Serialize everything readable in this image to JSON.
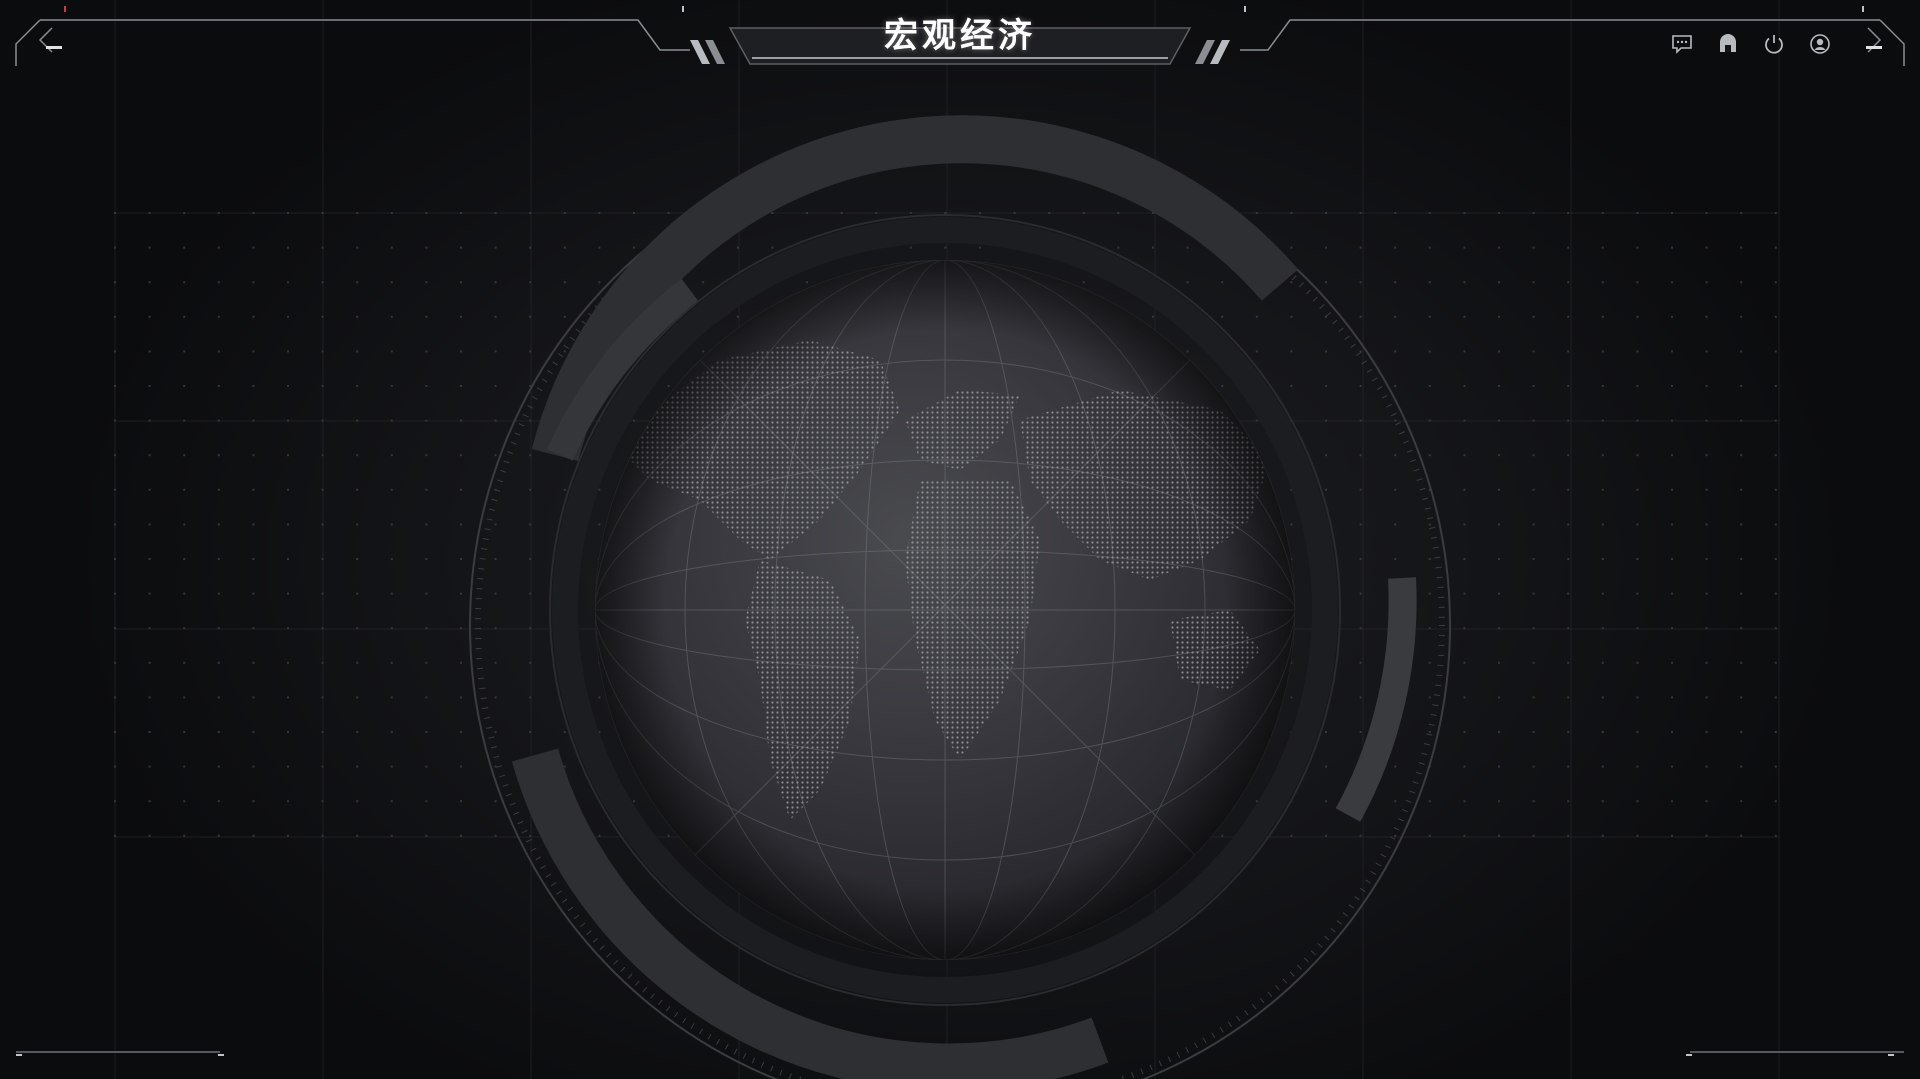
{
  "header": {
    "title": "宏观经济"
  },
  "toolbar": {
    "items": [
      {
        "icon": "message-icon",
        "name": "message-button"
      },
      {
        "icon": "home-icon",
        "name": "home-button"
      },
      {
        "icon": "power-icon",
        "name": "power-button"
      },
      {
        "icon": "user-icon",
        "name": "user-button"
      }
    ]
  },
  "colors": {
    "background": "#0b0c0e",
    "frame_line": "#8a8d92",
    "accent_red": "#d23a3a",
    "title_text": "#ffffff"
  }
}
